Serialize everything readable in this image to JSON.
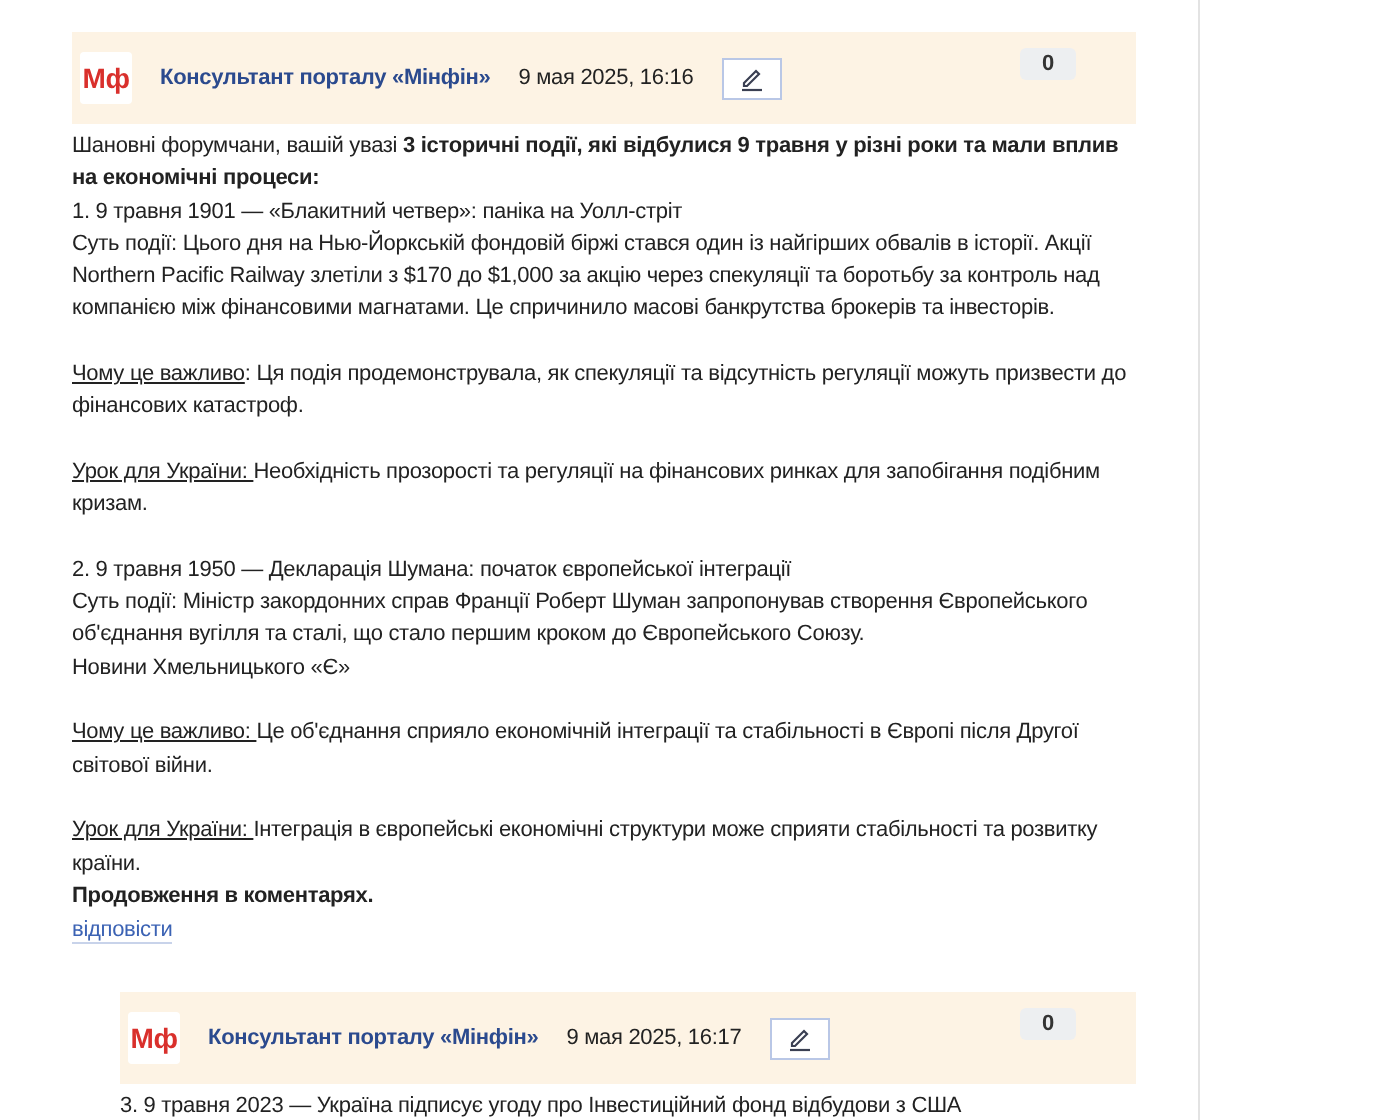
{
  "comments": [
    {
      "logo": "Мф",
      "author": "Консультант порталу «Мінфін»",
      "date": "9 мая 2025, 16:16",
      "votes": "0",
      "reply": "відповісти",
      "blocks": [
        [
          {
            "kind": "plain",
            "text": "Шановні форумчани, вашій увазі **3 історичні події, які відбулися 9 травня у різні роки та мали вплив на економічні процеси:**"
          },
          {
            "kind": "plain",
            "text": "1. 9 травня 1901 — «Блакитний четвер»: паніка на Уолл-стріт"
          },
          {
            "kind": "plain",
            "text": "Суть події: Цього дня на Нью-Йоркській фондовій біржі стався один із найгірших обвалів в історії. Акції Northern Pacific Railway злетіли з $170 до $1,000 за акцію через спекуляції та боротьбу за контроль над компанією між фінансовими магнатами. Це спричинило масові банкрутства брокерів та інвесторів."
          }
        ],
        [
          {
            "kind": "labeled",
            "label": "Чому це важливо",
            "text": ": Ця подія продемонструвала, як спекуляції та відсутність регуляції можуть призвести до фінансових катастроф."
          }
        ],
        [
          {
            "kind": "labeled",
            "label": "Урок для України: ",
            "text": "Необхідність прозорості та регуляції на фінансових ринках для запобігання подібним кризам."
          }
        ],
        [
          {
            "kind": "plain",
            "text": "2. 9 травня 1950 — Декларація Шумана: початок європейської інтеграції"
          },
          {
            "kind": "plain",
            "text": "Суть події: Міністр закордонних справ Франції Роберт Шуман запропонував створення Європейського об'єднання вугілля та сталі, що стало першим кроком до Європейського Союзу."
          },
          {
            "kind": "plain",
            "text": "Новини Хмельницького «Є»"
          }
        ],
        [
          {
            "kind": "labeled",
            "label": "Чому це важливо: ",
            "text": "Це об'єднання сприяло економічній інтеграції та стабільності в Європі після Другої світової війни."
          }
        ],
        [
          {
            "kind": "labeled",
            "label": "Урок для України: ",
            "text": "Інтеграція в європейські економічні структури може сприяти стабільності та розвитку країни."
          },
          {
            "kind": "bold",
            "text": "Продовження в коментарях."
          }
        ]
      ]
    },
    {
      "logo": "Мф",
      "author": "Консультант порталу «Мінфін»",
      "date": "9 мая 2025, 16:17",
      "votes": "0",
      "blocks": [
        [
          {
            "kind": "plain",
            "text": "3. 9 травня 2023 — Україна підписує угоду про Інвестиційний фонд відбудови з США"
          }
        ]
      ]
    }
  ]
}
